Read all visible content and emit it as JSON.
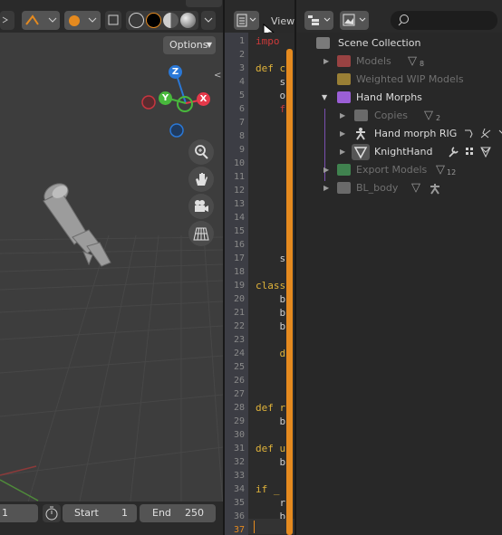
{
  "viewport": {
    "options_label": "Options",
    "gizmo": {
      "z_label": "Z",
      "y_label": "Y",
      "x_label": "X"
    },
    "colors": {
      "background": "#3d3d3d",
      "axis_x": "#e5394a",
      "axis_y": "#48b83c",
      "axis_z": "#2a78d7"
    }
  },
  "text_editor": {
    "view_label": "View",
    "lines": [
      {
        "n": "1",
        "code": "impo",
        "color": "#cc3a3a"
      },
      {
        "n": "2",
        "code": "",
        "color": "#d0d0d0"
      },
      {
        "n": "3",
        "code": "def c",
        "color": "#e0b33a"
      },
      {
        "n": "4",
        "code": "    s",
        "color": "#cfcfcf"
      },
      {
        "n": "5",
        "code": "    o",
        "color": "#cfcfcf"
      },
      {
        "n": "6",
        "code": "    f",
        "color": "#cc3a3a"
      },
      {
        "n": "7",
        "code": "",
        "color": "#d0d0d0"
      },
      {
        "n": "8",
        "code": "",
        "color": "#d0d0d0"
      },
      {
        "n": "9",
        "code": "",
        "color": "#d0d0d0"
      },
      {
        "n": "10",
        "code": "",
        "color": "#d0d0d0"
      },
      {
        "n": "11",
        "code": "",
        "color": "#d0d0d0"
      },
      {
        "n": "12",
        "code": "",
        "color": "#d0d0d0"
      },
      {
        "n": "13",
        "code": "",
        "color": "#d0d0d0"
      },
      {
        "n": "14",
        "code": "",
        "color": "#d0d0d0"
      },
      {
        "n": "15",
        "code": "",
        "color": "#d0d0d0"
      },
      {
        "n": "16",
        "code": "",
        "color": "#d0d0d0"
      },
      {
        "n": "17",
        "code": "    s",
        "color": "#cfcfcf"
      },
      {
        "n": "18",
        "code": "",
        "color": "#d0d0d0"
      },
      {
        "n": "19",
        "code": "class",
        "color": "#e0b33a"
      },
      {
        "n": "20",
        "code": "    b",
        "color": "#cfcfcf"
      },
      {
        "n": "21",
        "code": "    b",
        "color": "#cfcfcf"
      },
      {
        "n": "22",
        "code": "    b",
        "color": "#cfcfcf"
      },
      {
        "n": "23",
        "code": "",
        "color": "#d0d0d0"
      },
      {
        "n": "24",
        "code": "    d",
        "color": "#e0b33a"
      },
      {
        "n": "25",
        "code": "",
        "color": "#d0d0d0"
      },
      {
        "n": "26",
        "code": "",
        "color": "#d0d0d0"
      },
      {
        "n": "27",
        "code": "",
        "color": "#d0d0d0"
      },
      {
        "n": "28",
        "code": "def r",
        "color": "#e0b33a"
      },
      {
        "n": "29",
        "code": "    b",
        "color": "#cfcfcf"
      },
      {
        "n": "30",
        "code": "",
        "color": "#d0d0d0"
      },
      {
        "n": "31",
        "code": "def u",
        "color": "#e0b33a"
      },
      {
        "n": "32",
        "code": "    b",
        "color": "#cfcfcf"
      },
      {
        "n": "33",
        "code": "",
        "color": "#d0d0d0"
      },
      {
        "n": "34",
        "code": "if _",
        "color": "#e0b33a"
      },
      {
        "n": "35",
        "code": "    r",
        "color": "#cfcfcf"
      },
      {
        "n": "36",
        "code": "    b",
        "color": "#cfcfcf"
      },
      {
        "n": "37",
        "code": "",
        "color": "#d0d0d0"
      }
    ],
    "current_line": "37",
    "colors": {
      "scrollbar": "#e58a1f",
      "keyword": "#e0b33a"
    }
  },
  "outliner": {
    "scene_collection": "Scene Collection",
    "items": [
      {
        "label": "Models",
        "badge": "8",
        "dim": true,
        "color": "#c84d4d"
      },
      {
        "label": "Weighted WIP Models",
        "badge": "",
        "dim": true,
        "color": "#c9a43a"
      },
      {
        "label": "Hand Morphs",
        "badge": "",
        "dim": false,
        "color": "#9b5fd6"
      },
      {
        "label": "Copies",
        "badge": "2",
        "dim": true,
        "color": "#8a8a8a"
      },
      {
        "label": "Hand morph RIG",
        "badge": "",
        "dim": false,
        "color": "#bfbfbf"
      },
      {
        "label": "KnightHand",
        "badge": "",
        "dim": false,
        "color": "#bfbfbf"
      },
      {
        "label": "Export Models",
        "badge": "12",
        "dim": true,
        "color": "#4aa860"
      },
      {
        "label": "BL_body",
        "badge": "",
        "dim": true,
        "color": "#8a8a8a"
      }
    ]
  },
  "timeline": {
    "current_frame": "1",
    "start_label": "Start",
    "start_value": "1",
    "end_label": "End",
    "end_value": "250"
  }
}
